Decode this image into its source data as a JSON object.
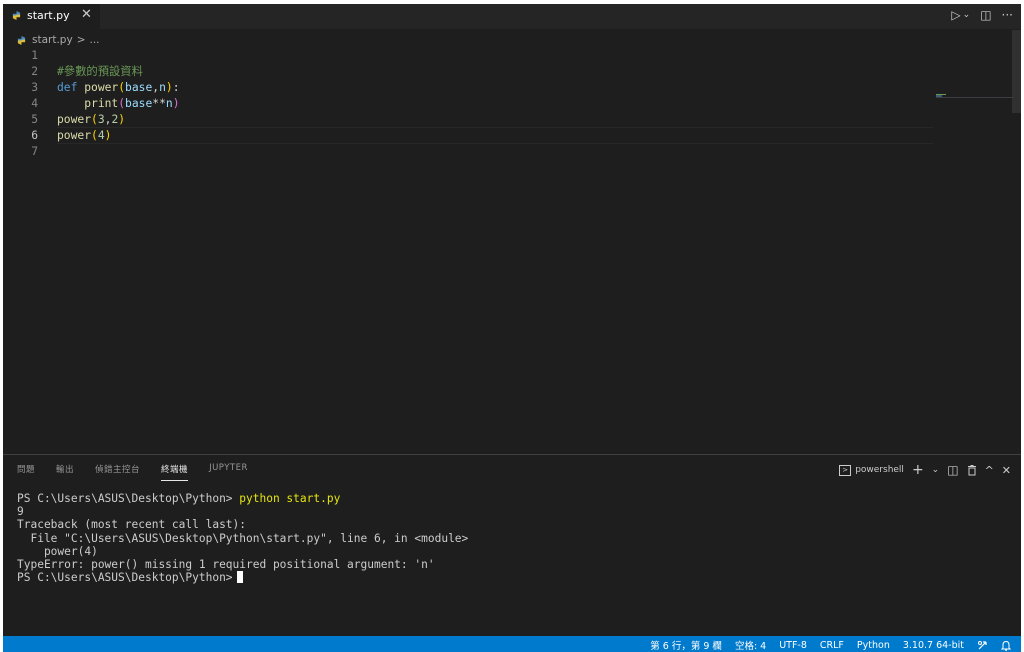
{
  "tab": {
    "filename": "start.py",
    "close": "✕"
  },
  "tab_actions": {
    "run": "▷",
    "run_dropdown": "⌄",
    "split": "◫",
    "more": "···"
  },
  "breadcrumb": {
    "file": "start.py",
    "sep": ">",
    "rest": "..."
  },
  "editor": {
    "line_numbers": [
      "1",
      "2",
      "3",
      "4",
      "5",
      "6",
      "7"
    ],
    "lines": [
      "",
      "#參數的預設資料",
      "def power(base,n):",
      "    print(base**n)",
      "power(3,2)",
      "power(4)",
      ""
    ],
    "active_line": 6
  },
  "panel": {
    "tabs": [
      "問題",
      "輸出",
      "偵錯主控台",
      "終端機",
      "JUPYTER"
    ],
    "active_tab": "終端機",
    "shell_name": "powershell",
    "actions": {
      "new": "+",
      "dropdown": "⌄",
      "split": "◫",
      "trash": "🗑",
      "maximize": "^",
      "close": "✕"
    }
  },
  "terminal": {
    "prompt_cmd_prefix": "PS C:\\Users\\ASUS\\Desktop\\Python> ",
    "command": "python start.py",
    "output": [
      "9",
      "Traceback (most recent call last):",
      "  File \"C:\\Users\\ASUS\\Desktop\\Python\\start.py\", line 6, in <module>",
      "    power(4)",
      "TypeError: power() missing 1 required positional argument: 'n'"
    ],
    "final_prompt": "PS C:\\Users\\ASUS\\Desktop\\Python>"
  },
  "statusbar": {
    "position": "第 6 行，第 9 欄",
    "spaces": "空格: 4",
    "encoding": "UTF-8",
    "eol": "CRLF",
    "language": "Python",
    "interpreter": "3.10.7 64-bit"
  },
  "colors": {
    "editor_bg": "#1e1e1e",
    "statusbar_bg": "#007acc",
    "keyword": "#569cd6",
    "function": "#dcdcaa",
    "variable": "#9cdcfe",
    "number": "#b5cea8",
    "comment": "#6a9955",
    "bracket": "#ffd700",
    "terminal_command": "#e5e510"
  }
}
